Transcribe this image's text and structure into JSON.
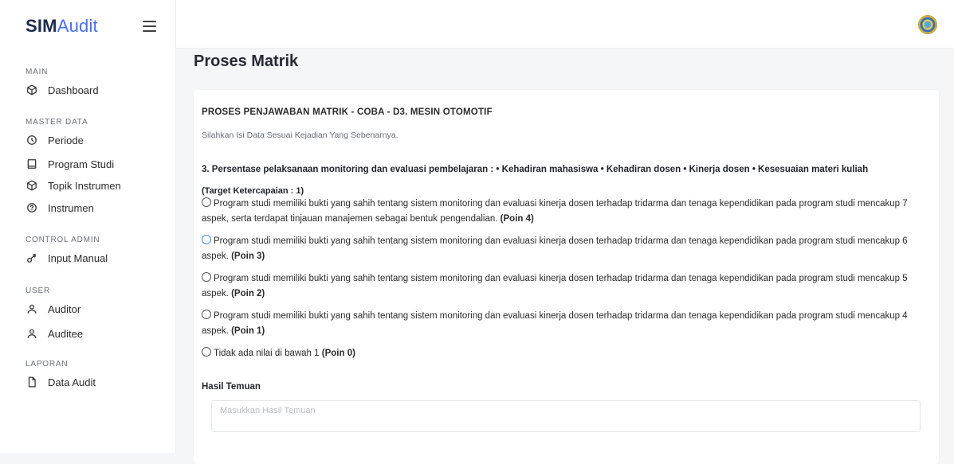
{
  "brand": {
    "bold": "SIM",
    "light": "Audit"
  },
  "sidebar": {
    "sections": [
      {
        "title": "MAIN",
        "items": [
          {
            "label": "Dashboard",
            "icon": "cube-icon"
          }
        ]
      },
      {
        "title": "MASTER DATA",
        "items": [
          {
            "label": "Periode",
            "icon": "clock-icon"
          },
          {
            "label": "Program Studi",
            "icon": "book-icon"
          },
          {
            "label": "Topik Instrumen",
            "icon": "cube-icon"
          },
          {
            "label": "Instrumen",
            "icon": "help-circle-icon"
          }
        ]
      },
      {
        "title": "CONTROL ADMIN",
        "items": [
          {
            "label": "Input Manual",
            "icon": "key-icon"
          }
        ]
      },
      {
        "title": "USER",
        "items": [
          {
            "label": "Auditor",
            "icon": "user-icon"
          },
          {
            "label": "Auditee",
            "icon": "user-icon"
          }
        ]
      },
      {
        "title": "LAPORAN",
        "items": [
          {
            "label": "Data Audit",
            "icon": "file-icon"
          }
        ]
      }
    ]
  },
  "page": {
    "title": "Proses Matrik"
  },
  "card": {
    "title": "PROSES PENJAWABAN MATRIK - COBA - D3. MESIN OTOMOTIF",
    "subtitle": "Silahkan Isi Data Sesuai Kejadian Yang Sebenarnya.",
    "question": "3. Persentase pelaksanaan monitoring dan evaluasi pembelajaran : • Kehadiran mahasiswa • Kehadiran dosen • Kinerja dosen • Kesesuaian materi kuliah",
    "target": "(Target Ketercapaian : 1)",
    "options": [
      {
        "text": "Program studi memiliki bukti yang sahih tentang sistem monitoring dan evaluasi kinerja dosen terhadap tridarma dan tenaga kependidikan pada program studi mencakup 7 aspek, serta terdapat tinjauan manajemen sebagai bentuk pengendalian.",
        "poin": "(Poin 4)"
      },
      {
        "text": "Program studi memiliki bukti yang sahih tentang sistem monitoring dan evaluasi kinerja dosen terhadap tridarma dan tenaga kependidikan pada program studi mencakup 6 aspek.",
        "poin": "(Poin 3)"
      },
      {
        "text": "Program studi memiliki bukti yang sahih tentang sistem monitoring dan evaluasi kinerja dosen terhadap tridarma dan tenaga kependidikan pada program studi mencakup 5 aspek.",
        "poin": "(Poin 2)"
      },
      {
        "text": "Program studi memiliki bukti yang sahih tentang sistem monitoring dan evaluasi kinerja dosen terhadap tridarma dan tenaga kependidikan pada program studi mencakup 4 aspek.",
        "poin": "(Poin 1)"
      },
      {
        "text": "Tidak ada nilai di bawah 1",
        "poin": "(Poin 0)"
      }
    ],
    "result_label": "Hasil Temuan",
    "result_placeholder": "Masukkan Hasil Temuan",
    "result_value": ""
  },
  "colors": {
    "brand_dark": "#1d2b4f",
    "brand_accent": "#4a6cf7",
    "page_bg": "#f4f6f8"
  }
}
